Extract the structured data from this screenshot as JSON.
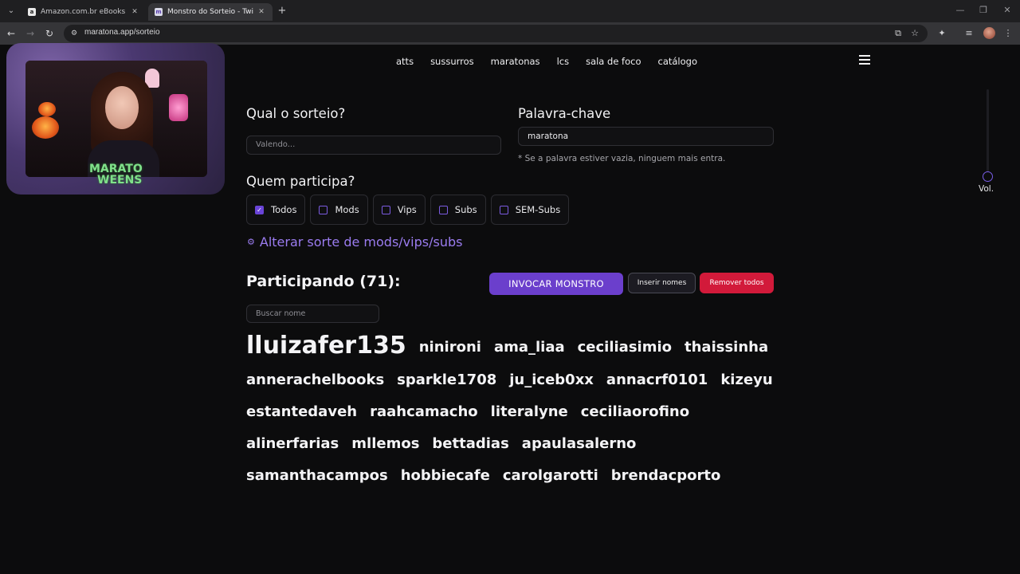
{
  "browser": {
    "tabs": [
      {
        "title": "Amazon.com.br eBooks Kindle:",
        "favicon": "a",
        "active": false
      },
      {
        "title": "Monstro do Sorteio - Twitch - M",
        "favicon": "m",
        "active": true
      }
    ],
    "url": "maratona.app/sorteio",
    "close_glyph": "✕",
    "new_tab_glyph": "+"
  },
  "site": {
    "logo_fragment": "a",
    "nav": [
      "atts",
      "sussurros",
      "maratonas",
      "lcs",
      "sala de foco",
      "catálogo"
    ]
  },
  "form": {
    "giveaway_label": "Qual o sorteio?",
    "giveaway_placeholder": "Valendo...",
    "keyword_label": "Palavra-chave",
    "keyword_value": "maratona",
    "keyword_note": "* Se a palavra estiver vazia, ninguem mais entra.",
    "who_label": "Quem participa?",
    "options": [
      {
        "label": "Todos",
        "checked": true
      },
      {
        "label": "Mods",
        "checked": false
      },
      {
        "label": "Vips",
        "checked": false
      },
      {
        "label": "Subs",
        "checked": false
      },
      {
        "label": "SEM-Subs",
        "checked": false
      }
    ],
    "luck_link": "Alterar sorte de mods/vips/subs"
  },
  "participants": {
    "heading": "Participando (71):",
    "search_placeholder": "Buscar nome",
    "summon_button": "INVOCAR MONSTRO",
    "insert_button": "Inserir nomes",
    "remove_button": "Remover todos",
    "rows": [
      [
        "lluizafer135",
        "ninironi",
        "ama_liaa",
        "ceciliasimio",
        "thaissinha"
      ],
      [
        "annerachelbooks",
        "sparkle1708",
        "ju_iceb0xx",
        "annacrf0101",
        "kizeyu"
      ],
      [
        "estantedaveh",
        "raahcamacho",
        "literalyne",
        "ceciliaorofino"
      ],
      [
        "alinerfarias",
        "mllemos",
        "bettadias",
        "apaulasalerno"
      ],
      [
        "samanthacampos",
        "hobbiecafe",
        "carolgarotti",
        "brendacporto"
      ]
    ]
  },
  "volume": {
    "label": "Vol."
  },
  "webcam": {
    "overlay_title_line1": "MARATO",
    "overlay_title_line2": "WEENS"
  },
  "colors": {
    "accent": "#6b3fcc",
    "link": "#9b7cf0",
    "danger": "#d21a3a",
    "background": "#0c0c0d"
  }
}
